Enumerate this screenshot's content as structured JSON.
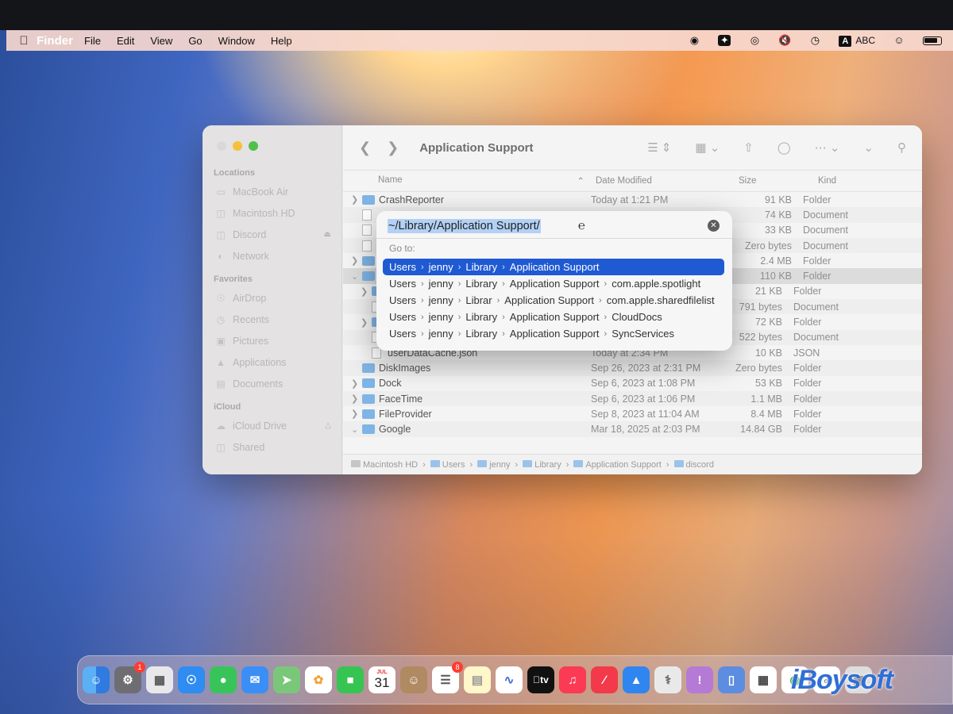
{
  "menubar": {
    "app_name": "Finder",
    "items": [
      "File",
      "Edit",
      "View",
      "Go",
      "Window",
      "Help"
    ],
    "input_source": "ABC"
  },
  "finder": {
    "title": "Application Support",
    "sidebar": {
      "locations_header": "Locations",
      "locations": [
        "MacBook Air",
        "Macintosh HD",
        "Discord",
        "Network"
      ],
      "favorites_header": "Favorites",
      "favorites": [
        "AirDrop",
        "Recents",
        "Pictures",
        "Applications",
        "Documents"
      ],
      "icloud_header": "iCloud",
      "icloud": [
        "iCloud Drive",
        "Shared"
      ]
    },
    "columns": {
      "name": "Name",
      "date": "Date Modified",
      "size": "Size",
      "kind": "Kind"
    },
    "rows": [
      {
        "name": "CrashReporter",
        "date": "Today at 1:21 PM",
        "size": "91 KB",
        "kind": "Folder"
      },
      {
        "name": "",
        "date": "",
        "size": "74 KB",
        "kind": "Document"
      },
      {
        "name": "",
        "date": "",
        "size": "33 KB",
        "kind": "Document"
      },
      {
        "name": "",
        "date": "",
        "size": "Zero bytes",
        "kind": "Document"
      },
      {
        "name": "",
        "date": "",
        "size": "2.4 MB",
        "kind": "Folder"
      },
      {
        "name": "",
        "date": "",
        "size": "110 KB",
        "kind": "Folder"
      },
      {
        "name": "",
        "date": "",
        "size": "21 KB",
        "kind": "Folder"
      },
      {
        "name": "",
        "date": "",
        "size": "791 bytes",
        "kind": "Document"
      },
      {
        "name": "",
        "date": "",
        "size": "72 KB",
        "kind": "Folder"
      },
      {
        "name": "",
        "date": "",
        "size": "522 bytes",
        "kind": "Document"
      },
      {
        "name": "userDataCache.json",
        "date": "Today at 2:34 PM",
        "size": "10 KB",
        "kind": "JSON"
      },
      {
        "name": "DiskImages",
        "date": "Sep 26, 2023 at 2:31 PM",
        "size": "Zero bytes",
        "kind": "Folder"
      },
      {
        "name": "Dock",
        "date": "Sep 6, 2023 at 1:08 PM",
        "size": "53 KB",
        "kind": "Folder"
      },
      {
        "name": "FaceTime",
        "date": "Sep 6, 2023 at 1:06 PM",
        "size": "1.1 MB",
        "kind": "Folder"
      },
      {
        "name": "FileProvider",
        "date": "Sep 8, 2023 at 11:04 AM",
        "size": "8.4 MB",
        "kind": "Folder"
      },
      {
        "name": "Google",
        "date": "Mar 18, 2025 at 2:03 PM",
        "size": "14.84 GB",
        "kind": "Folder"
      }
    ],
    "path": [
      "Macintosh HD",
      "Users",
      "jenny",
      "Library",
      "Application Support",
      "discord"
    ]
  },
  "goto": {
    "input_value": "~/Library/Application Support/",
    "label": "Go to:",
    "suggestions": [
      [
        "Users",
        "jenny",
        "Library",
        "Application Support"
      ],
      [
        "Users",
        "jenny",
        "Library",
        "Application Support",
        "com.apple.spotlight"
      ],
      [
        "Users",
        "jenny",
        "Librar",
        "Application Support",
        "com.apple.sharedfilelist"
      ],
      [
        "Users",
        "jenny",
        "Library",
        "Application Support",
        "CloudDocs"
      ],
      [
        "Users",
        "jenny",
        "Library",
        "Application Support",
        "SyncServices"
      ]
    ]
  },
  "dock": {
    "settings_badge": "1",
    "calendar_month": "JUL",
    "calendar_day": "31",
    "reminders_badge": "8",
    "tv_label": "tv"
  },
  "watermark": "iBoysoft"
}
